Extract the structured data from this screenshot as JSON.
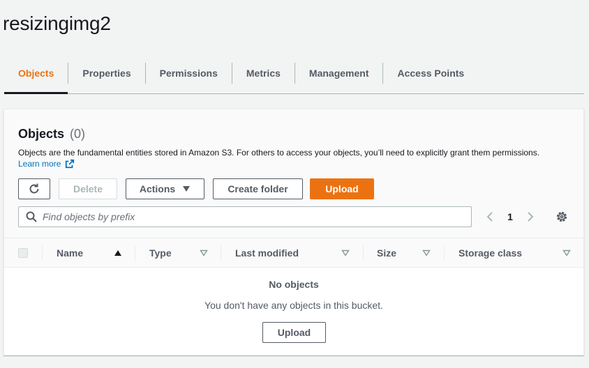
{
  "bucket": {
    "name": "resizingimg2"
  },
  "tabs": [
    {
      "label": "Objects",
      "active": true
    },
    {
      "label": "Properties",
      "active": false
    },
    {
      "label": "Permissions",
      "active": false
    },
    {
      "label": "Metrics",
      "active": false
    },
    {
      "label": "Management",
      "active": false
    },
    {
      "label": "Access Points",
      "active": false
    }
  ],
  "objects_panel": {
    "title": "Objects",
    "count": "(0)",
    "description": "Objects are the fundamental entities stored in Amazon S3. For others to access your objects, you’ll need to explicitly grant them permissions.",
    "learn_more": "Learn more"
  },
  "toolbar": {
    "refresh_icon": "refresh-icon",
    "delete_label": "Delete",
    "actions_label": "Actions",
    "create_folder_label": "Create folder",
    "upload_label": "Upload"
  },
  "search": {
    "placeholder": "Find objects by prefix",
    "value": ""
  },
  "pagination": {
    "current_page": "1"
  },
  "table": {
    "columns": [
      {
        "label": "Name",
        "sort": "ascending"
      },
      {
        "label": "Type",
        "sort": "none"
      },
      {
        "label": "Last modified",
        "sort": "none"
      },
      {
        "label": "Size",
        "sort": "none"
      },
      {
        "label": "Storage class",
        "sort": "none"
      }
    ]
  },
  "empty_state": {
    "title": "No objects",
    "description": "You don't have any objects in this bucket.",
    "upload_label": "Upload"
  },
  "colors": {
    "accent": "#ec7211",
    "link": "#0073bb",
    "text": "#16191f",
    "secondary_text": "#545b64"
  }
}
